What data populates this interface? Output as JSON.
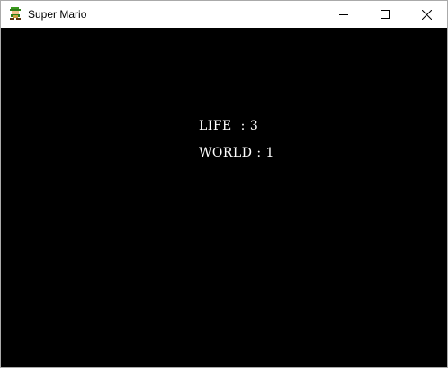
{
  "window": {
    "title": "Super Mario",
    "icon": "mario-sprite-icon"
  },
  "controls": {
    "minimize_icon": "minimize-icon",
    "maximize_icon": "maximize-icon",
    "close_icon": "close-icon"
  },
  "hud": {
    "life_text": "LIFE  : 3",
    "world_text": "WORLD : 1",
    "lives": 3,
    "world": 1
  },
  "colors": {
    "background": "#000000",
    "text": "#ffffff",
    "titlebar": "#ffffff"
  }
}
